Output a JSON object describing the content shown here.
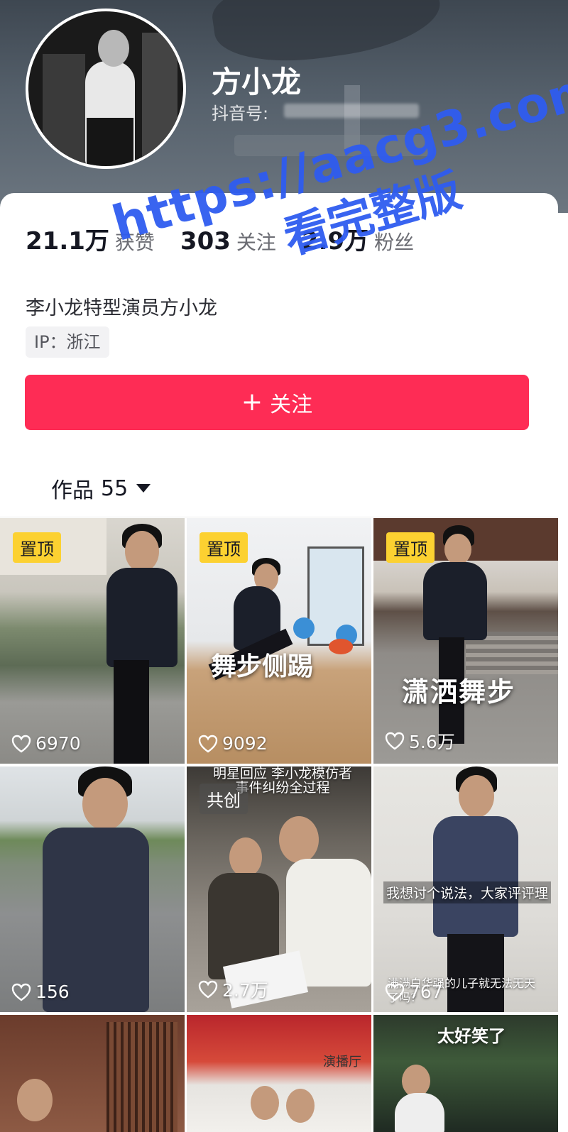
{
  "profile": {
    "name": "方小龙",
    "douyin_id_label": "抖音号:",
    "stats": [
      {
        "value": "21.1万",
        "label": "获赞"
      },
      {
        "value": "303",
        "label": "关注"
      },
      {
        "value": "2.9万",
        "label": "粉丝"
      }
    ],
    "bio": "李小龙特型演员方小龙",
    "ip": "IP：浙江",
    "follow_button": "关注"
  },
  "works_tab": {
    "label": "作品",
    "count": "55"
  },
  "videos": [
    {
      "badge": "置顶",
      "overlay": "",
      "likes": "6970"
    },
    {
      "badge": "置顶",
      "overlay": "舞步侧踢",
      "likes": "9092"
    },
    {
      "badge": "置顶",
      "overlay": "潇洒舞步",
      "likes": "5.6万"
    },
    {
      "badge": "",
      "overlay": "",
      "likes": "156"
    },
    {
      "badge": "共创",
      "overlay_top": "明星回应 李小龙模仿者 事件纠纷全过程",
      "likes": "2.7万"
    },
    {
      "badge": "",
      "overlay": "我想讨个说法，大家评评理",
      "overlay_bottom": "满满白华强的儿子就无法无天 了吗?",
      "likes": "767"
    },
    {
      "badge": "",
      "overlay": "",
      "likes": ""
    },
    {
      "badge": "",
      "overlay": "演播厅",
      "likes": ""
    },
    {
      "badge": "",
      "overlay": "太好笑了",
      "likes": ""
    }
  ],
  "watermark": {
    "line1": "https://aacg3.com",
    "line2": "看完整版"
  },
  "colors": {
    "follow_red": "#fe2c55",
    "pin_yellow": "#fcd131",
    "watermark_blue": "#2f5cf0"
  }
}
